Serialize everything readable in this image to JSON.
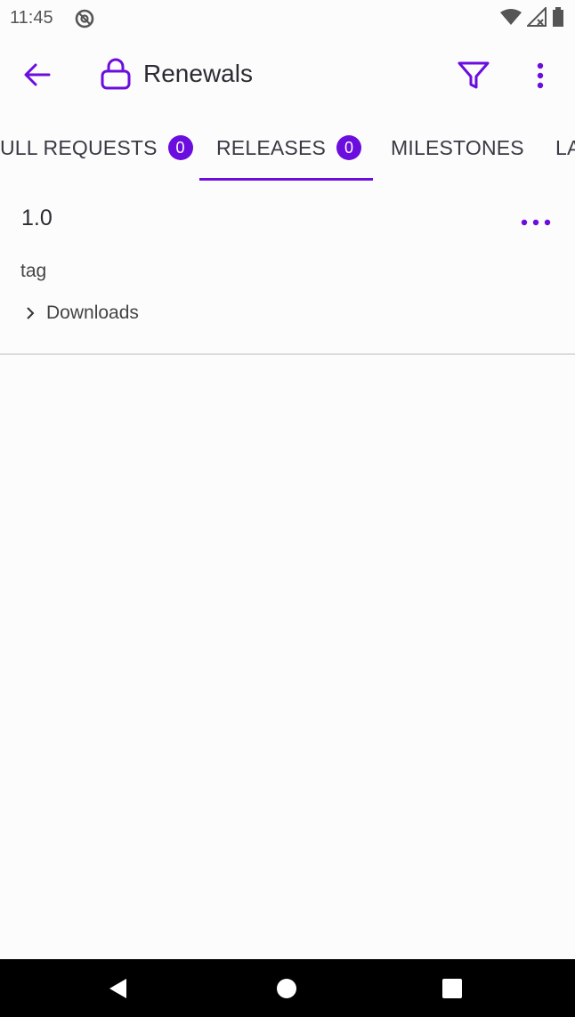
{
  "status_bar": {
    "time": "11:45",
    "icons": [
      "do-not-disturb-icon",
      "wifi-icon",
      "signal-icon",
      "battery-icon"
    ]
  },
  "app_bar": {
    "title": "Renewals",
    "icons": [
      "back-arrow-icon",
      "lock-icon",
      "filter-icon",
      "more-vertical-icon"
    ],
    "accent_color": "#6a0dde"
  },
  "tabs": [
    {
      "label": "PULL REQUESTS",
      "visible_label": "ULL REQUESTS",
      "badge": "0",
      "selected": false
    },
    {
      "label": "RELEASES",
      "badge": "0",
      "selected": true
    },
    {
      "label": "MILESTONES",
      "selected": false
    },
    {
      "label": "LA",
      "selected": false
    }
  ],
  "releases": [
    {
      "version": "1.0",
      "tag": "tag",
      "downloads_label": "Downloads"
    }
  ],
  "nav_bar": {
    "icons": [
      "back-triangle-icon",
      "home-circle-icon",
      "recents-square-icon"
    ]
  }
}
